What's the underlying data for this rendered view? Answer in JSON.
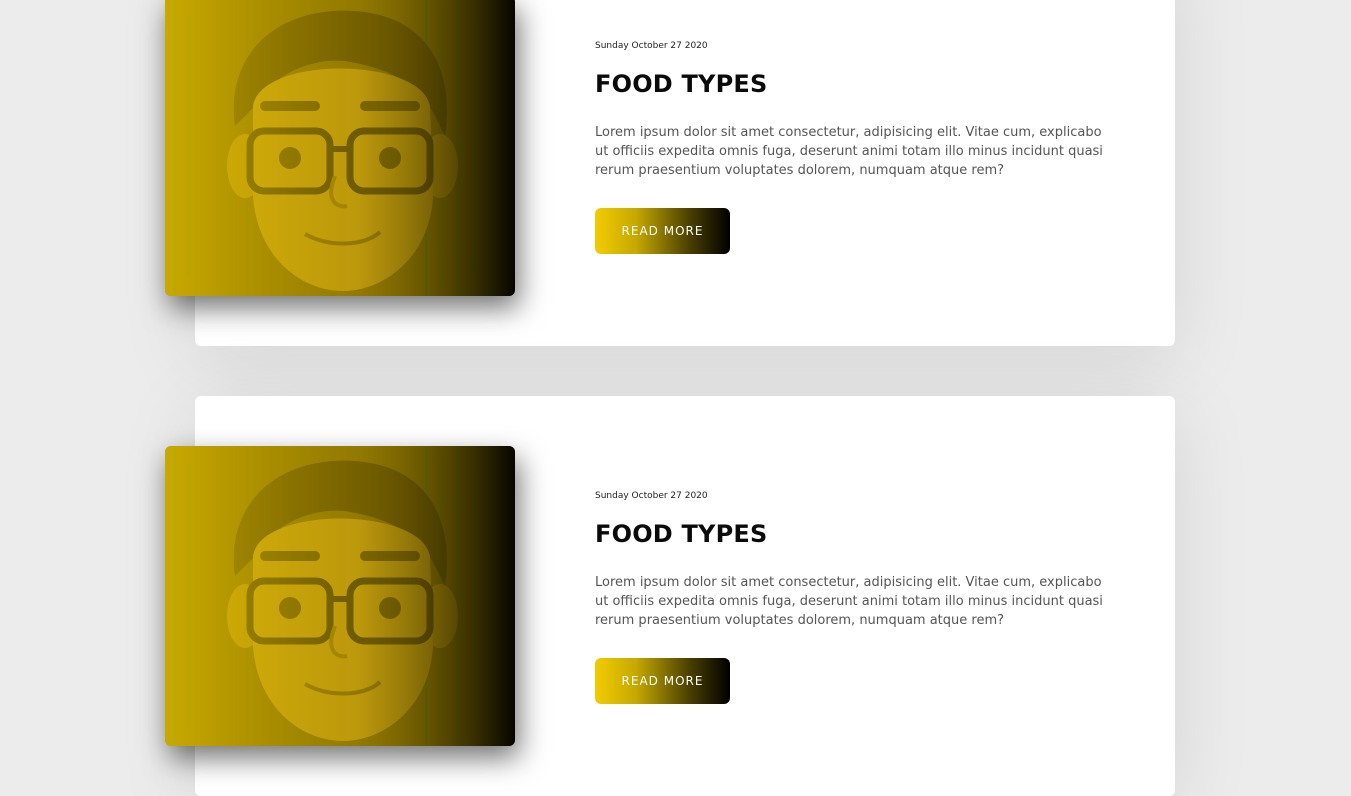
{
  "posts": [
    {
      "date": "Sunday October 27 2020",
      "title": "FOOD TYPES",
      "description": "Lorem ipsum dolor sit amet consectetur, adipisicing elit. Vitae cum, explicabo ut officiis expedita omnis fuga, deserunt animi totam illo minus incidunt quasi rerum praesentium voluptates dolorem, numquam atque rem?",
      "button_label": "READ MORE",
      "image_icon": "avatar-illustration"
    },
    {
      "date": "Sunday October 27 2020",
      "title": "FOOD TYPES",
      "description": "Lorem ipsum dolor sit amet consectetur, adipisicing elit. Vitae cum, explicabo ut officiis expedita omnis fuga, deserunt animi totam illo minus incidunt quasi rerum praesentium voluptates dolorem, numquam atque rem?",
      "button_label": "READ MORE",
      "image_icon": "avatar-illustration"
    }
  ],
  "colors": {
    "background": "#ececec",
    "card": "#ffffff",
    "accent_yellow": "#f2cc00",
    "accent_black": "#000000"
  }
}
